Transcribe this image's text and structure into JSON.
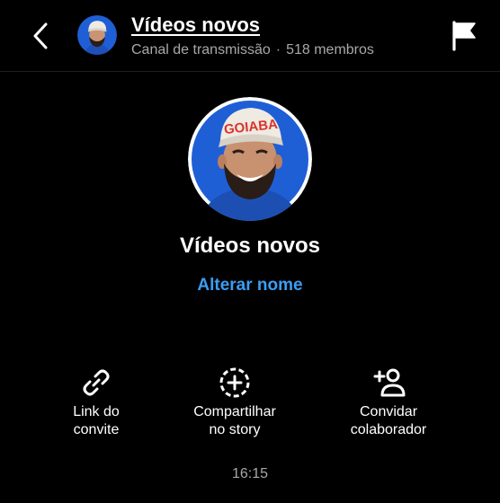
{
  "header": {
    "title": "Vídeos novos",
    "subtitle": "Canal de transmissão",
    "separator": "·",
    "members": "518 membros"
  },
  "profile": {
    "name": "Vídeos novos",
    "rename_label": "Alterar nome",
    "cap_text": "GOIABA",
    "avatar_bg": "#1f5fd6",
    "cap_color": "#f1ece4",
    "cap_text_color": "#d9352b"
  },
  "actions": [
    {
      "icon": "link-icon",
      "label": "Link do\nconvite"
    },
    {
      "icon": "add-story-icon",
      "label": "Compartilhar\nno story"
    },
    {
      "icon": "add-person-icon",
      "label": "Convidar\ncolaborador"
    }
  ],
  "timestamp": "16:15",
  "colors": {
    "background": "#000000",
    "text": "#ffffff",
    "muted": "#a8a8a8",
    "accent": "#3b9df5"
  }
}
